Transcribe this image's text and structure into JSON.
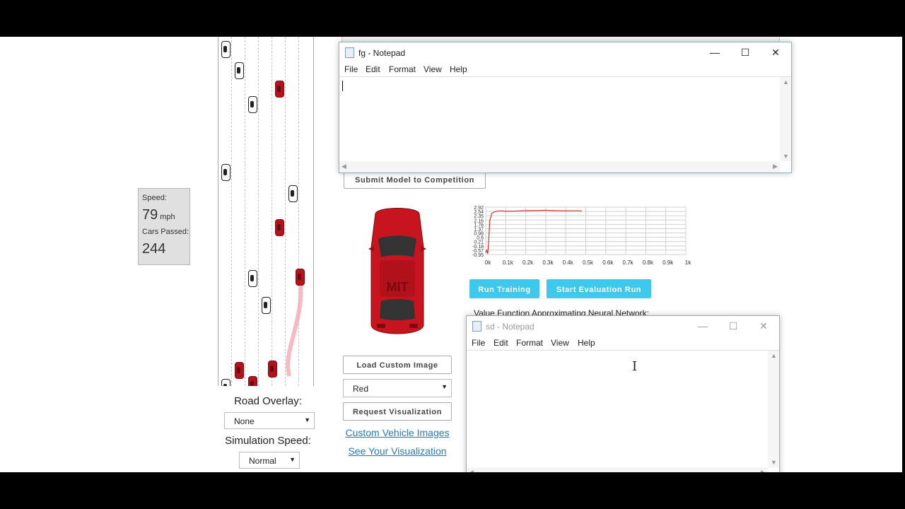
{
  "speed_panel": {
    "speed_label": "Speed:",
    "speed_value": "79",
    "speed_unit": "mph",
    "cars_passed_label": "Cars Passed:",
    "cars_passed_value": "244"
  },
  "road_overlay": {
    "label": "Road Overlay:",
    "value": "None"
  },
  "simulation_speed": {
    "label": "Simulation Speed:",
    "value": "Normal"
  },
  "submit_button": "Submit Model to Competition",
  "load_image_button": "Load Custom Image",
  "color_select": "Red",
  "request_viz_button": "Request Visualization",
  "custom_images_link": "Custom Vehicle Images",
  "see_viz_link": "See Your Visualization",
  "run_training_button": "Run Training",
  "start_eval_button": "Start Evaluation Run",
  "nn_label": "Value Function Approximating Neural Network:",
  "car_logo": "MIT",
  "notepad_fg": {
    "title": "fg - Notepad",
    "menu": [
      "File",
      "Edit",
      "Format",
      "View",
      "Help"
    ],
    "content": ""
  },
  "notepad_sd": {
    "title": "sd - Notepad",
    "menu": [
      "File",
      "Edit",
      "Format",
      "View",
      "Help"
    ],
    "content": ""
  },
  "window_controls": {
    "minimize": "—",
    "maximize": "☐",
    "close": "✕"
  },
  "colors": {
    "accent": "#3ec9ec",
    "car_red": "#b5121b",
    "chart_line": "#c0392b"
  },
  "chart_data": {
    "type": "line",
    "x_tick_labels": [
      "0k",
      "0.1k",
      "0.2k",
      "0.3k",
      "0.4k",
      "0.5k",
      "0.6k",
      "0.7k",
      "0.8k",
      "0.9k",
      "1k"
    ],
    "y_tick_labels": [
      "2.92",
      "2.54",
      "2.35",
      "2.16",
      "1.76",
      "1.37",
      "0.98",
      "0.6",
      "0.21",
      "-0.18",
      "-0.57",
      "-0.95"
    ],
    "ylim": [
      -0.95,
      2.92
    ],
    "xlim": [
      0,
      1000
    ],
    "grid": true,
    "series": [
      {
        "x": [
          0,
          5,
          10,
          15,
          20,
          30,
          45,
          60,
          80,
          100,
          150,
          200,
          250,
          300,
          350,
          400,
          480
        ],
        "y": [
          -0.8,
          -0.6,
          -0.9,
          0.2,
          1.8,
          2.4,
          2.55,
          2.6,
          2.62,
          2.58,
          2.6,
          2.63,
          2.64,
          2.66,
          2.63,
          2.62,
          2.62
        ]
      }
    ]
  }
}
